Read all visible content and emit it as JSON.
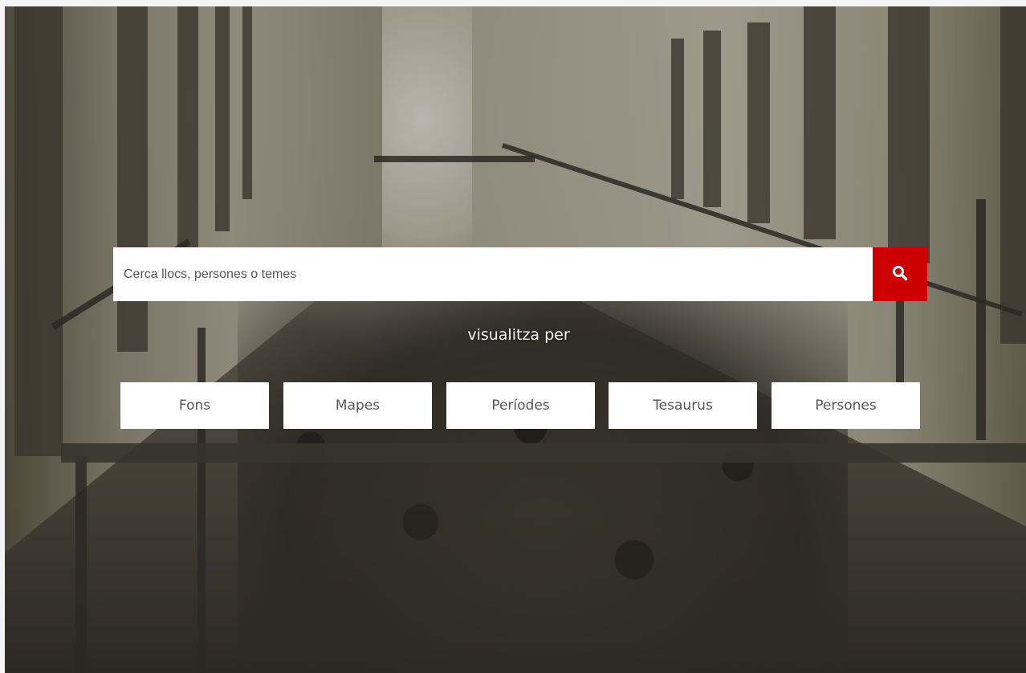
{
  "search": {
    "placeholder": "Cerca llocs, persones o temes",
    "button_icon": "search-icon",
    "button_color": "#cc0000"
  },
  "visualize": {
    "label": "visualitza per"
  },
  "browse_buttons": [
    {
      "label": "Fons"
    },
    {
      "label": "Mapes"
    },
    {
      "label": "Períodes"
    },
    {
      "label": "Tesaurus"
    },
    {
      "label": "Persones"
    }
  ]
}
